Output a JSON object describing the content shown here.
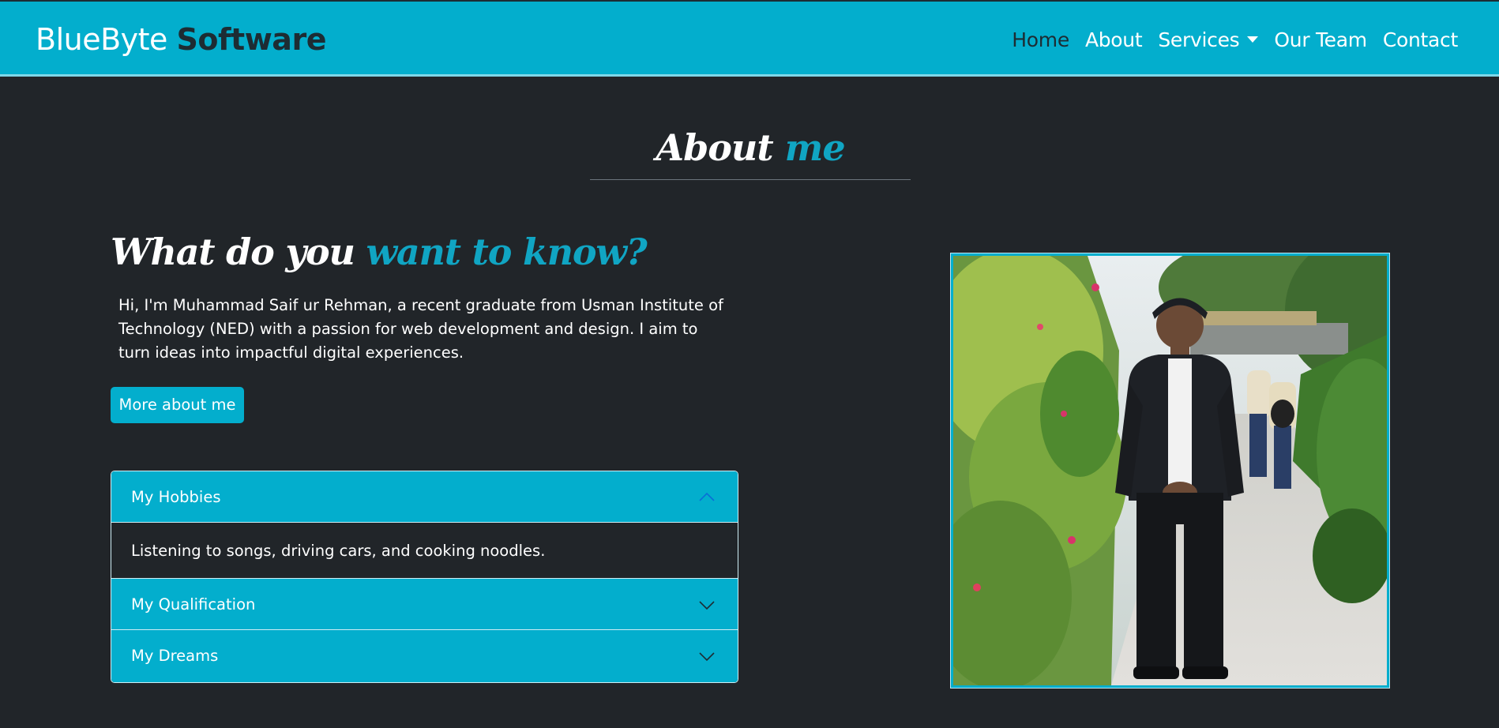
{
  "brand": {
    "part1": "BlueByte",
    "part2": "Software"
  },
  "nav": {
    "home": "Home",
    "about": "About",
    "services": "Services",
    "team": "Our Team",
    "contact": "Contact"
  },
  "section": {
    "title_main": "About",
    "title_accent": "me"
  },
  "intro": {
    "heading_main": "What do you",
    "heading_accent": "want to know?",
    "text": "Hi, I'm Muhammad Saif ur Rehman, a recent graduate from Usman Institute of Technology (NED) with a passion for web development and design. I aim to turn ideas into impactful digital experiences.",
    "button": "More about me"
  },
  "accordion": {
    "items": [
      {
        "label": "My Hobbies",
        "body": "Listening to songs, driving cars, and cooking noodles.",
        "expanded": true
      },
      {
        "label": "My Qualification",
        "expanded": false
      },
      {
        "label": "My Dreams",
        "expanded": false
      }
    ]
  },
  "colors": {
    "accent": "#03aecd",
    "background": "#212529",
    "brand_dark": "#1d2c33"
  },
  "icons": {
    "caret": "caret-down-icon",
    "open": "chevron-up-icon",
    "closed": "chevron-down-icon"
  }
}
